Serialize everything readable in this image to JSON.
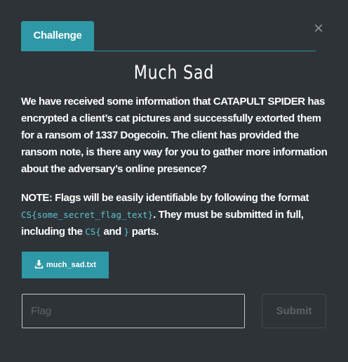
{
  "modal": {
    "tab_label": "Challenge",
    "close_symbol": "×",
    "title": "Much Sad"
  },
  "description": "We have received some information that CATAPULT SPIDER has encrypted a client’s cat pictures and successfully extorted them for a ransom of 1337 Dogecoin. The client has provided the ransom note, is there any way for you to gather more information about the adversary’s online presence?",
  "note": {
    "part1": "NOTE: Flags will be easily identifiable by following the format ",
    "code_format": "CS{some_secret_flag_text}",
    "part2": ". They must be submitted in full, including the ",
    "code_open": "CS{",
    "part3": " and ",
    "code_close": "}",
    "part4": " parts."
  },
  "file": {
    "label": "much_sad.txt",
    "icon": "download-icon"
  },
  "form": {
    "flag_placeholder": "Flag",
    "flag_value": "",
    "submit_label": "Submit"
  },
  "colors": {
    "background": "#2d3337",
    "accent": "#2e98a6",
    "code": "#5ec2d0"
  }
}
